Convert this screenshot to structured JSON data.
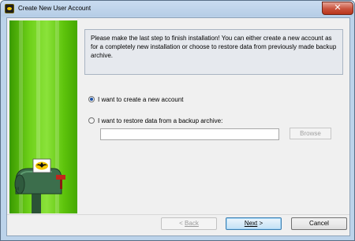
{
  "window": {
    "title": "Create New User Account",
    "close_symbol": "✕"
  },
  "message": "Please make the last step to finish installation! You can either create a new account as for a completely new installation or choose to restore data from previously made backup archive.",
  "options": {
    "create": {
      "label": "I want to create a new account",
      "checked": true
    },
    "restore": {
      "label": "I want to restore data from a backup archive:",
      "checked": false
    }
  },
  "restore_path": {
    "value": ""
  },
  "browse_label": "Browse",
  "buttons": {
    "back": {
      "arrow": "<",
      "label": "Back",
      "enabled": false
    },
    "next": {
      "label": "Next",
      "arrow": ">",
      "enabled": true
    },
    "cancel": {
      "label": "Cancel",
      "enabled": true
    }
  },
  "colors": {
    "side_panel": "#6fd11a",
    "mailbox": "#2e5a3c",
    "flag": "#c0261c",
    "logo": "#f2c600"
  },
  "icons": {
    "app": "bat-icon",
    "side_art": "mailbox-icon"
  }
}
